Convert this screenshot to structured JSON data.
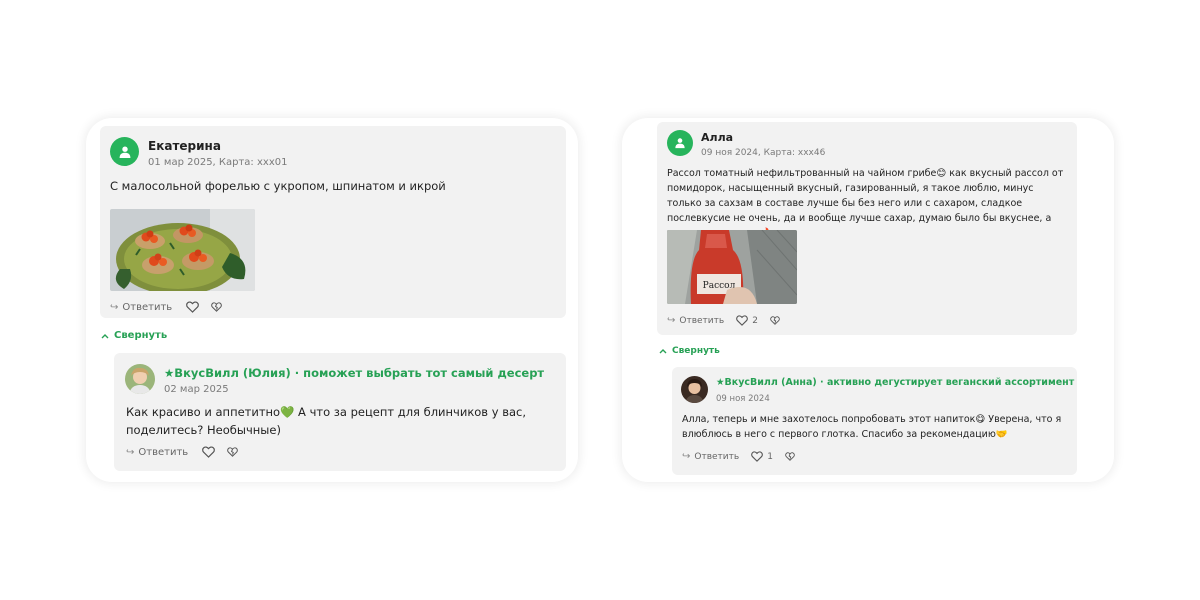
{
  "reviews": [
    {
      "author": "Екатерина",
      "meta": "01 мар 2025, Карта: xxx01",
      "text": "С малосольной форелью с укропом, шпинатом и икрой",
      "reply_label": "Ответить",
      "collapse_label": "Свернуть",
      "answer": {
        "author": "★ВкусВилл (Юлия) · поможет выбрать тот самый десерт",
        "date": "02 мар 2025",
        "text": "Как красиво и аппетитно💚 А что за рецепт для блинчиков у вас, поделитесь? Необычные)",
        "reply_label": "Ответить"
      }
    },
    {
      "author": "Алла",
      "meta": "09 ноя 2024, Карта: xxx46",
      "text": "Рассол томатный нефильтрованный на чайном грибе😊 как вкусный рассол от помидорок, насыщенный вкусный, газированный, я такое люблю, минус только за сахзам в составе лучше бы без него или с сахаром, сладкое послевкусие не очень, да и вообще лучше сахар, думаю было бы вкуснее, а так супер напиток🔥",
      "bottle_label": "Рассол",
      "reply_label": "Ответить",
      "likes": "2",
      "collapse_label": "Свернуть",
      "answer": {
        "author": "★ВкусВилл (Анна) · активно дегустирует веганский ассортимент",
        "date": "09 ноя 2024",
        "text": "Алла, теперь и мне захотелось попробовать этот напиток😋 Уверена, что я влюблюсь в него с первого глотка. Спасибо за рекомендацию🤝",
        "reply_label": "Ответить",
        "likes": "1"
      }
    }
  ],
  "colors": {
    "brand_green": "#27a155",
    "avatar_green": "#27b45c",
    "card_bg": "#f2f2f2"
  },
  "icons": [
    "user-icon",
    "reply-icon",
    "heart-icon",
    "broken-heart-icon",
    "chevron-up-icon"
  ]
}
